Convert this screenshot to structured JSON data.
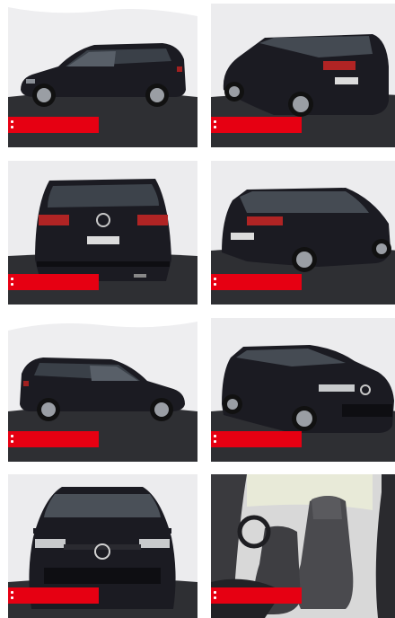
{
  "gallery": {
    "tiles": [
      {
        "id": "side-left",
        "label_text": "",
        "view_icon": "car-side-left-icon"
      },
      {
        "id": "rear-three-quarter-left",
        "label_text": "",
        "view_icon": "car-rear-three-quarter-icon"
      },
      {
        "id": "rear",
        "label_text": "",
        "view_icon": "car-rear-icon"
      },
      {
        "id": "rear-three-quarter-right",
        "label_text": "",
        "view_icon": "car-rear-three-quarter-icon"
      },
      {
        "id": "side-right",
        "label_text": "",
        "view_icon": "car-side-right-icon"
      },
      {
        "id": "front-three-quarter-right",
        "label_text": "",
        "view_icon": "car-front-three-quarter-icon"
      },
      {
        "id": "front",
        "label_text": "",
        "view_icon": "car-front-icon"
      },
      {
        "id": "interior-front-seats",
        "label_text": "",
        "view_icon": "car-seat-icon"
      }
    ]
  },
  "colors": {
    "label_bar": "#e60012",
    "studio_wall": "#ececee",
    "studio_floor": "#2e2f33",
    "car_body": "#1b1b22"
  }
}
